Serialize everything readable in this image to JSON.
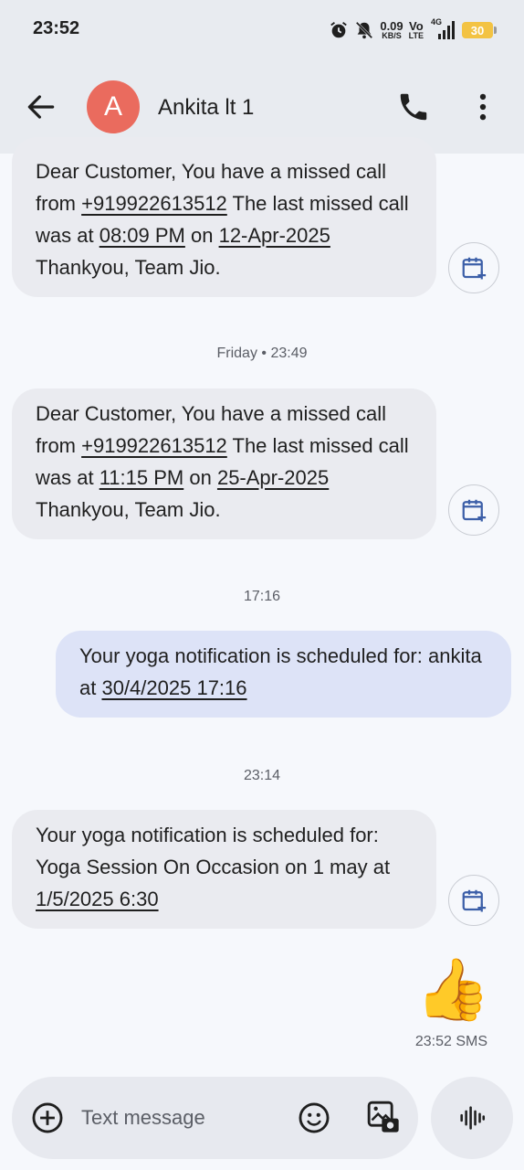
{
  "status_bar": {
    "time": "23:52",
    "net_speed_value": "0.09",
    "net_speed_unit": "KB/S",
    "volte_top": "Vo",
    "volte_bottom": "LTE",
    "network": "4G",
    "battery": "30",
    "icons": [
      "alarm-icon",
      "bell-off-icon",
      "signal-icon",
      "battery-icon"
    ]
  },
  "header": {
    "avatar_letter": "A",
    "avatar_color": "#ea6b5e",
    "contact_name": "Ankita lt 1",
    "icons": [
      "back-arrow-icon",
      "phone-icon",
      "more-vert-icon"
    ]
  },
  "messages": [
    {
      "direction": "incoming",
      "segments": [
        "Dear Customer, You have a missed call from ",
        "+919922613512",
        " The last missed call was at ",
        "08:09 PM",
        " on ",
        "12-Apr-2025",
        " Thankyou, Team Jio."
      ]
    },
    {
      "direction": "incoming",
      "segments": [
        "Dear Customer, You have a missed call from ",
        "+919922613512",
        " The last missed call was at ",
        "11:15 PM",
        " on ",
        "25-Apr-2025",
        " Thankyou, Team Jio."
      ]
    },
    {
      "direction": "outgoing",
      "segments": [
        "Your yoga notification is scheduled for: ankita at ",
        "30/4/2025 17:16"
      ]
    },
    {
      "direction": "incoming",
      "segments": [
        "Your yoga notification is scheduled for: Yoga Session On Occasion on 1 may at ",
        "1/5/2025 6:30"
      ]
    },
    {
      "direction": "outgoing",
      "emoji": "👍",
      "time": "23:52",
      "type": "SMS"
    }
  ],
  "timestamps": [
    "Friday • 23:49",
    "17:16",
    "23:14"
  ],
  "compose": {
    "placeholder": "Text message",
    "icons": [
      "add-icon",
      "emoji-icon",
      "gallery-icon",
      "voice-icon"
    ]
  },
  "colors": {
    "incoming_bubble": "#eaebf0",
    "outgoing_bubble": "#dde3f7",
    "background": "#f6f8fc",
    "header_bg": "#e8ebf0"
  }
}
